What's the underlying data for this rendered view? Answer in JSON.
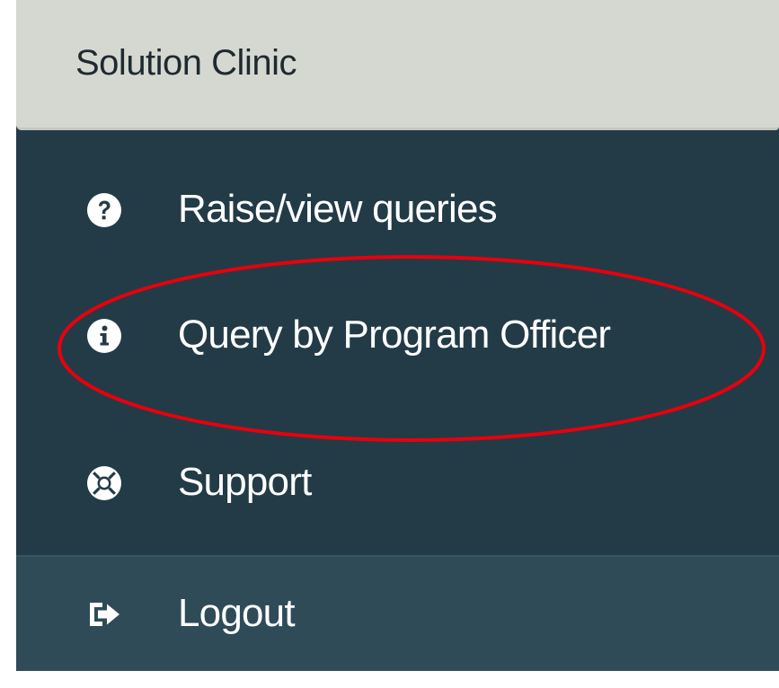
{
  "sidebar": {
    "section_title": "Solution Clinic",
    "items": [
      {
        "label": "Raise/view queries",
        "icon": "question-circle-icon"
      },
      {
        "label": "Query by Program Officer",
        "icon": "info-circle-icon"
      },
      {
        "label": "Support",
        "icon": "life-ring-icon"
      },
      {
        "label": "Logout",
        "icon": "sign-out-icon"
      }
    ]
  },
  "annotation": {
    "shape": "ellipse",
    "color": "#e8000d",
    "target": "Query by Program Officer"
  },
  "colors": {
    "sidebar_bg": "#223b47",
    "header_bg": "#d5d8d1",
    "logout_bg": "#2f4b58",
    "text": "#ffffff"
  }
}
